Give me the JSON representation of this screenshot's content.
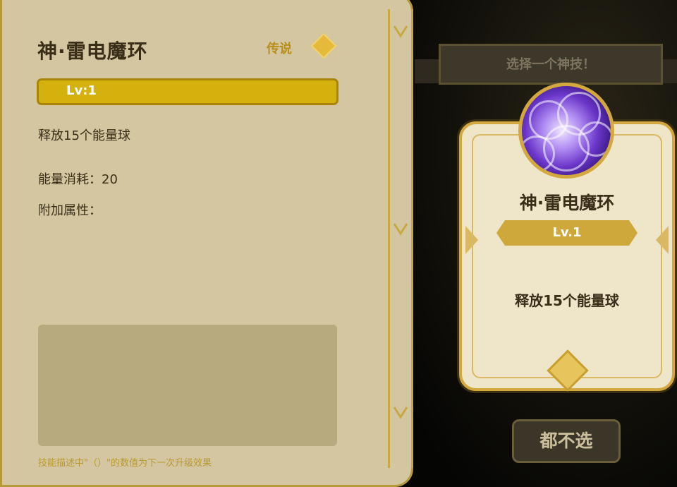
{
  "detail_panel": {
    "title": "神·雷电魔环",
    "rarity": "传说",
    "level": "Lv:1",
    "description": "释放15个能量球",
    "energy_cost": "能量消耗：20",
    "extra_attributes": "附加属性：",
    "hint": "技能描述中\"（）\"的数值为下一次升级效果"
  },
  "selection": {
    "header": "选择一个神技！",
    "card": {
      "skill_name": "神·雷电魔环",
      "level": "Lv.1",
      "description": "释放15个能量球",
      "icon": "purple-energy-orb-icon"
    },
    "skip_button": "都不选"
  },
  "colors": {
    "panel_bg": "#d3c6a0",
    "gold": "#d3a93f",
    "level_bar": "#d4b10c",
    "card_bg": "#efe6c9"
  }
}
